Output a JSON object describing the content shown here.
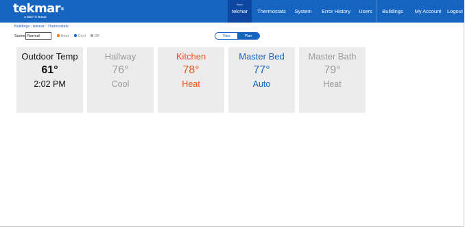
{
  "brand": {
    "name": "tekmar",
    "reg": "®",
    "tagline": "A WATTS Brand"
  },
  "nav": {
    "home_badge": "Home",
    "items": [
      {
        "label": "tekmar",
        "active": true
      },
      {
        "label": "Thermostats"
      },
      {
        "label": "System"
      },
      {
        "label": "Error History"
      },
      {
        "label": "Users"
      },
      {
        "label": "Buildings"
      },
      {
        "label": "My Account"
      },
      {
        "label": "Logout"
      }
    ]
  },
  "breadcrumb": "Buildings : tekmar : Thermostats",
  "scene": {
    "label": "Scene",
    "value": "Normal"
  },
  "legend": {
    "heat": {
      "label": "Heat",
      "color": "#f57c00"
    },
    "cool": {
      "label": "Cool",
      "color": "#1565c0"
    },
    "off": {
      "label": "Off",
      "color": "#9e9e9e"
    }
  },
  "view_toggle": {
    "tiles": "Tiles",
    "plan": "Plan",
    "selected": "Plan"
  },
  "colors": {
    "accent": "#1565c0",
    "heat": "#f4511e",
    "cool": "#1565c0",
    "idle": "#9a9a9a",
    "tile_bg": "#ececec"
  },
  "tiles": [
    {
      "name": "Outdoor Temp",
      "temp": "61°",
      "sub": "2:02 PM",
      "color": "#111111"
    },
    {
      "name": "Hallway",
      "temp": "76°",
      "sub": "Cool",
      "color": "#9a9a9a"
    },
    {
      "name": "Kitchen",
      "temp": "78°",
      "sub": "Heat",
      "color": "#f4511e"
    },
    {
      "name": "Master Bed",
      "temp": "77°",
      "sub": "Auto",
      "color": "#1565c0"
    },
    {
      "name": "Master Bath",
      "temp": "79°",
      "sub": "Heat",
      "color": "#9a9a9a"
    }
  ]
}
